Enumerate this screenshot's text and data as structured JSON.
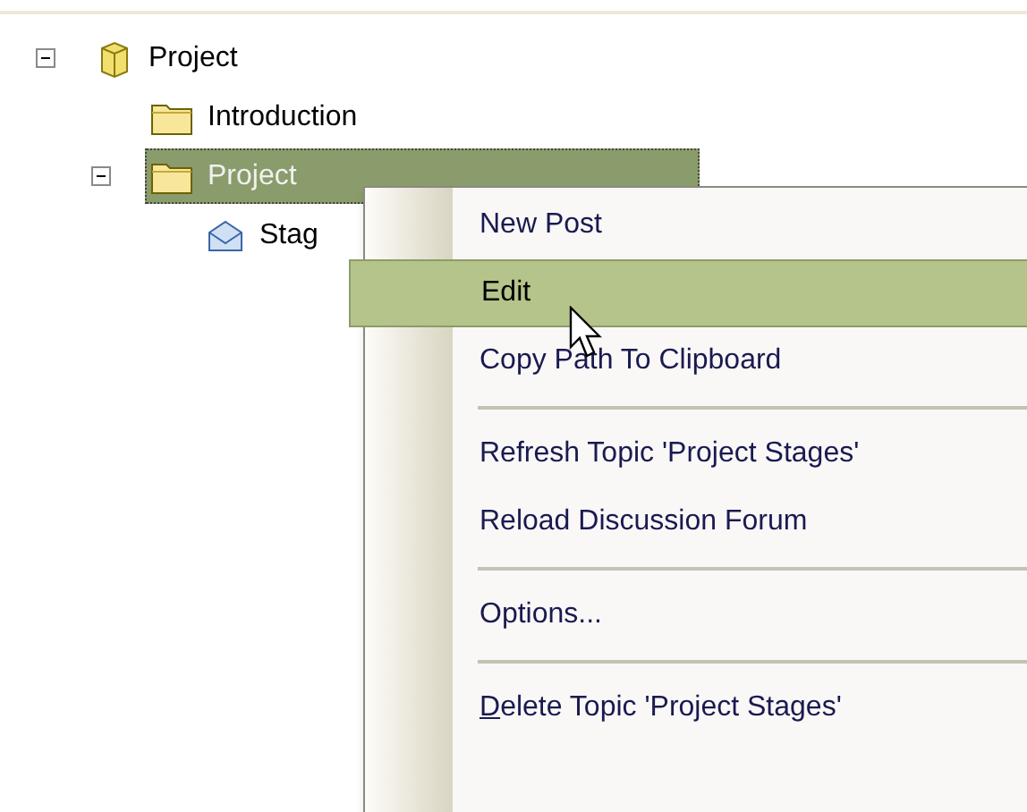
{
  "tree": [
    {
      "label": "Project",
      "kind": "project",
      "expanded": true,
      "selected": false,
      "children": [
        {
          "label": "Introduction",
          "kind": "folder",
          "selected": false
        },
        {
          "label": "Project",
          "kind": "folder",
          "expanded": true,
          "selected": true,
          "children": [
            {
              "label": "Stag",
              "kind": "post",
              "selected": false
            }
          ]
        }
      ]
    }
  ],
  "context_menu": {
    "items": [
      {
        "kind": "item",
        "label": "New Post",
        "selected": false
      },
      {
        "kind": "item",
        "label": "Edit",
        "selected": true
      },
      {
        "kind": "item",
        "label": "Copy Path To Clipboard",
        "selected": false
      },
      {
        "kind": "separator"
      },
      {
        "kind": "item",
        "label": "Refresh Topic 'Project Stages'",
        "selected": false
      },
      {
        "kind": "item",
        "label": "Reload Discussion Forum",
        "selected": false
      },
      {
        "kind": "separator"
      },
      {
        "kind": "item",
        "label": "Options...",
        "selected": false
      },
      {
        "kind": "separator"
      },
      {
        "kind": "item",
        "label": "Delete Topic 'Project Stages'",
        "selected": false,
        "mnemonic_underlined": true
      }
    ]
  }
}
